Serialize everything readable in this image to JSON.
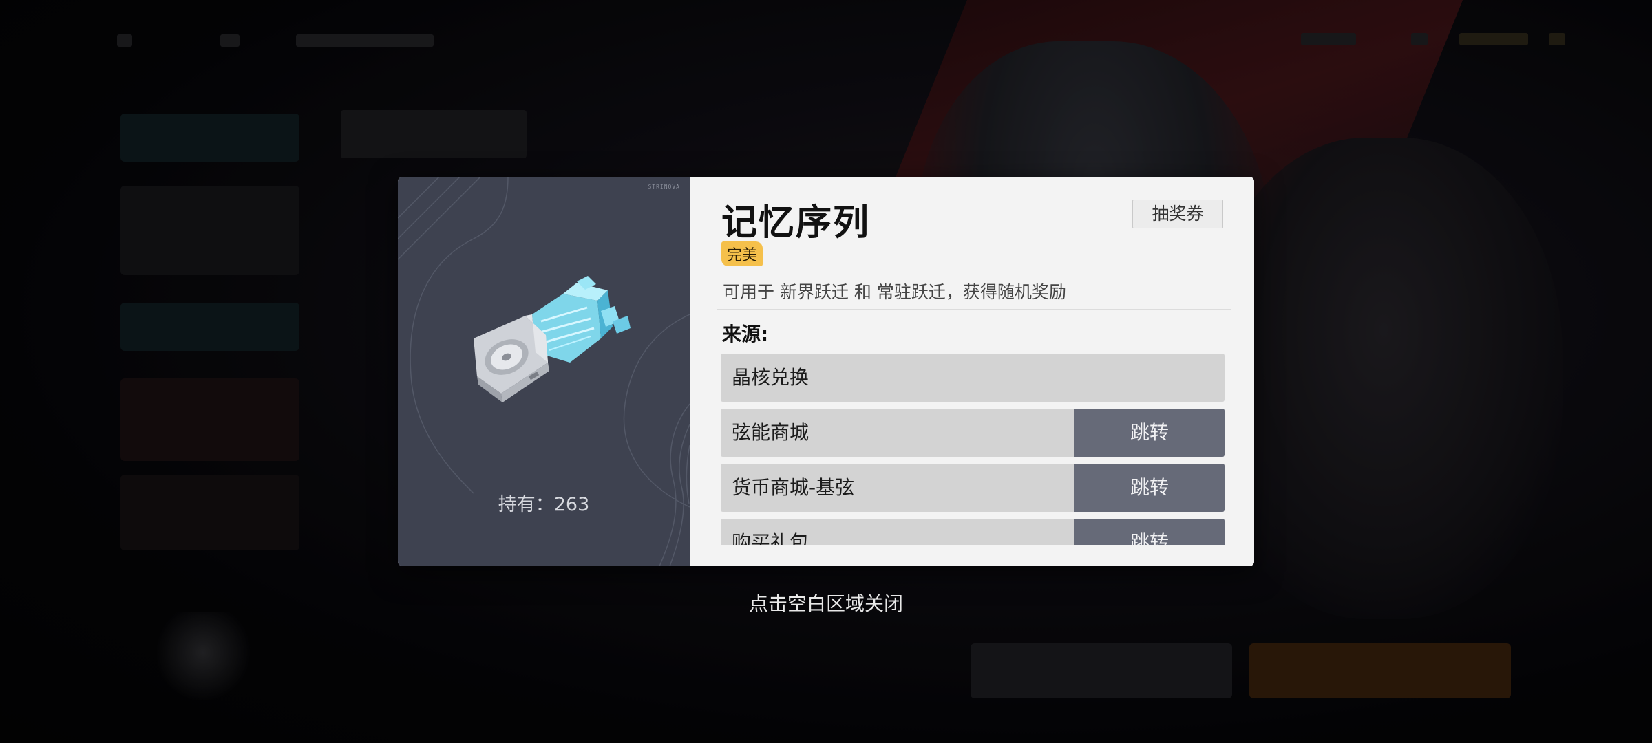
{
  "dialog": {
    "title": "记忆序列",
    "rarity": "完美",
    "lottery_button": "抽奖券",
    "description": "可用于 新界跃迁 和 常驻跃迁，获得随机奖励",
    "source_label": "来源:",
    "holding_label": "持有：",
    "holding_count": "263",
    "brand_mark": "STRINOVA",
    "sources": [
      {
        "name": "晶核兑换",
        "jump": ""
      },
      {
        "name": "弦能商城",
        "jump": "跳转"
      },
      {
        "name": "货币商城-基弦",
        "jump": "跳转"
      },
      {
        "name": "购买礼包",
        "jump": "跳转"
      }
    ]
  },
  "close_hint": "点击空白区域关闭",
  "colors": {
    "left_panel": "#3e4250",
    "right_panel": "#f3f3f3",
    "rarity_badge": "#f5c04b",
    "jump_button": "#666a78",
    "source_row": "#d3d3d3"
  },
  "icons": {
    "item_art": "memory-sequence-chip-icon"
  }
}
